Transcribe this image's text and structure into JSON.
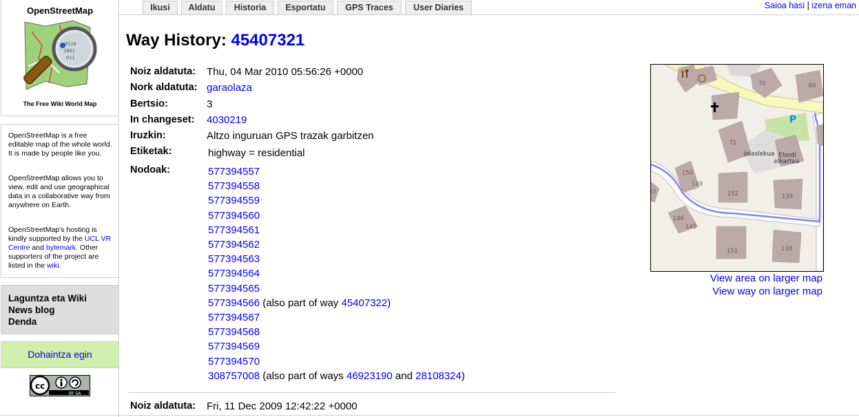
{
  "sidebar": {
    "logo_title": "OpenStreetMap",
    "logo_tagline": "The Free Wiki World Map",
    "intro_p1": "OpenStreetMap is a free editable map of the whole world. It is made by people like you.",
    "intro_p2": "OpenStreetMap allows you to view, edit and use geographical data in a collaborative way from anywhere on Earth.",
    "intro_p3_a": "OpenStreetMap's hosting is kindly supported by the ",
    "intro_p3_ucl": "UCL VR Centre",
    "intro_p3_b": " and ",
    "intro_p3_bytemark": "bytemark",
    "intro_p3_c": ". Other supporters of the project are listed in the ",
    "intro_p3_wiki": "wiki",
    "intro_p3_d": ".",
    "links": [
      "Laguntza eta Wiki",
      "News blog",
      "Denda"
    ],
    "donate": "Dohaintza egin",
    "license_badge": "BY SA"
  },
  "tabs": [
    "Ikusi",
    "Aldatu",
    "Historia",
    "Esportatu",
    "GPS Traces",
    "User Diaries"
  ],
  "usernav": {
    "login": "Saioa hasi",
    "separator": "|",
    "signup": "izena eman"
  },
  "page": {
    "title_prefix": "Way History: ",
    "way_id": "45407321"
  },
  "version": {
    "edited_label": "Noiz aldatuta:",
    "edited_value": "Thu, 04 Mar 2010 05:56:26 +0000",
    "editor_label": "Nork aldatuta:",
    "editor_value": "garaolaza",
    "version_label": "Bertsio:",
    "version_value": "3",
    "changeset_label": "In changeset:",
    "changeset_value": "4030219",
    "comment_label": "Iruzkin:",
    "comment_value": "Altzo inguruan GPS trazak garbitzen",
    "tags_label": "Etiketak:",
    "tags_value": "highway = residential",
    "nodes_label": "Nodoak:"
  },
  "nodes": [
    {
      "id": "577394557"
    },
    {
      "id": "577394558"
    },
    {
      "id": "577394559"
    },
    {
      "id": "577394560"
    },
    {
      "id": "577394561"
    },
    {
      "id": "577394562"
    },
    {
      "id": "577394563"
    },
    {
      "id": "577394564"
    },
    {
      "id": "577394565"
    },
    {
      "id": "577394566",
      "note_a": " (also part of way ",
      "way1": "45407322",
      "note_b": ")"
    },
    {
      "id": "577394567"
    },
    {
      "id": "577394568"
    },
    {
      "id": "577394569"
    },
    {
      "id": "577394570"
    },
    {
      "id": "308757008",
      "note_a": " (also part of ways ",
      "way1": "46923190",
      "note_mid": " and ",
      "way2": "28108324",
      "note_b": ")"
    }
  ],
  "next_version": {
    "edited_label": "Noiz aldatuta:",
    "edited_value": "Fri, 11 Dec 2009 12:42:22 +0000"
  },
  "map": {
    "labels": {
      "h70": "70",
      "h60": "60",
      "h71": "71",
      "h150": "150",
      "h149": "149",
      "h152": "152",
      "h139": "139",
      "h146": "146",
      "h145": "145",
      "h151": "151",
      "h138": "138",
      "h37": "37",
      "parking": "P",
      "park1": "jolaslekua",
      "park2a": "Elordi",
      "park2b": "elkartea"
    },
    "link_area": "View area on larger map",
    "link_way": "View way on larger map"
  },
  "colors": {
    "link": "#0000ee",
    "donate_bg": "#cef0ac",
    "links_bg": "#dddddd",
    "tab_bg": "#eeeeee",
    "way_highlight": "#8080ff",
    "building": "#bca9a9"
  }
}
